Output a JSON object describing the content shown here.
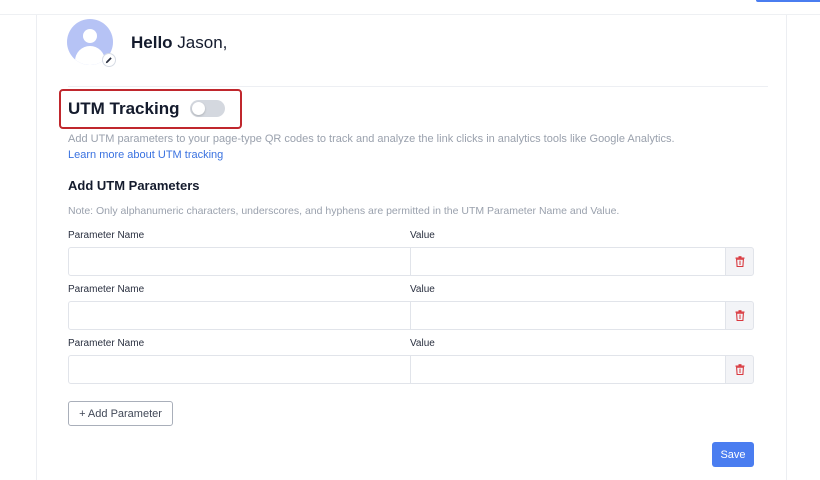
{
  "header": {
    "greeting_bold": "Hello",
    "greeting_name": "Jason,"
  },
  "utm": {
    "title": "UTM Tracking",
    "toggle_on": false,
    "description": "Add UTM parameters to your page-type QR codes to track and analyze the link clicks in analytics tools like Google Analytics.",
    "learn_more": "Learn more about UTM tracking"
  },
  "params": {
    "title": "Add UTM Parameters",
    "note": "Note: Only alphanumeric characters, underscores, and hyphens are permitted in the UTM Parameter Name and Value.",
    "rows": [
      {
        "name_label": "Parameter Name",
        "value_label": "Value",
        "name_value": "",
        "value_value": ""
      },
      {
        "name_label": "Parameter Name",
        "value_label": "Value",
        "name_value": "",
        "value_value": ""
      },
      {
        "name_label": "Parameter Name",
        "value_label": "Value",
        "name_value": "",
        "value_value": ""
      }
    ],
    "add_label": "+ Add Parameter"
  },
  "actions": {
    "save_label": "Save"
  },
  "colors": {
    "accent": "#4a7df0",
    "highlight_border": "#c0272d",
    "delete_icon": "#d9383e",
    "avatar": "#b6c3f5"
  },
  "icons": {
    "avatar": "user-avatar-icon",
    "edit": "pencil-icon",
    "delete": "trash-icon"
  }
}
